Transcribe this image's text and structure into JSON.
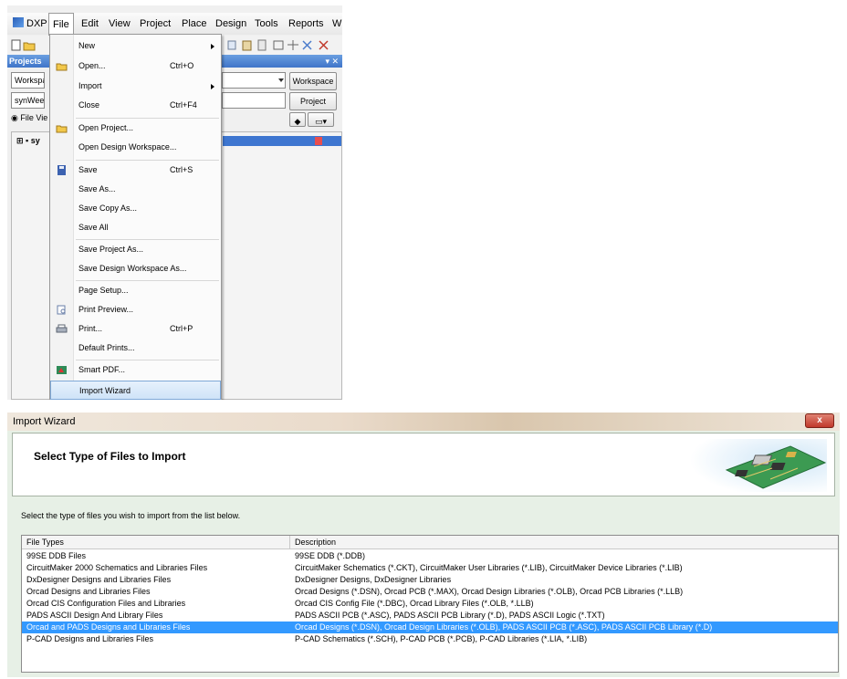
{
  "dxp": {
    "menubar": [
      "DXP",
      "File",
      "Edit",
      "View",
      "Project",
      "Place",
      "Design",
      "Tools",
      "Reports",
      "W"
    ],
    "projects_panel": {
      "title": "Projects",
      "workspace_field": "Workspa",
      "project_field": "synWee.I",
      "file_view_radio": "File Vie",
      "tree_item": "sy",
      "workspace_button": "Workspace",
      "project_button": "Project"
    },
    "file_menu": [
      {
        "label": "New",
        "shortcut": "",
        "submenu": true
      },
      {
        "label": "Open...",
        "shortcut": "Ctrl+O",
        "submenu": false
      },
      {
        "label": "Import",
        "shortcut": "",
        "submenu": true
      },
      {
        "label": "Close",
        "shortcut": "Ctrl+F4",
        "submenu": false
      },
      {
        "label": "Open Project...",
        "shortcut": "",
        "submenu": false
      },
      {
        "label": "Open Design Workspace...",
        "shortcut": "",
        "submenu": false
      },
      {
        "label": "Save",
        "shortcut": "Ctrl+S",
        "submenu": false
      },
      {
        "label": "Save As...",
        "shortcut": "",
        "submenu": false
      },
      {
        "label": "Save Copy As...",
        "shortcut": "",
        "submenu": false
      },
      {
        "label": "Save All",
        "shortcut": "",
        "submenu": false
      },
      {
        "label": "Save Project As...",
        "shortcut": "",
        "submenu": false
      },
      {
        "label": "Save Design Workspace As...",
        "shortcut": "",
        "submenu": false
      },
      {
        "label": "Page Setup...",
        "shortcut": "",
        "submenu": false
      },
      {
        "label": "Print Preview...",
        "shortcut": "",
        "submenu": false
      },
      {
        "label": "Print...",
        "shortcut": "Ctrl+P",
        "submenu": false
      },
      {
        "label": "Default Prints...",
        "shortcut": "",
        "submenu": false
      },
      {
        "label": "Smart PDF...",
        "shortcut": "",
        "submenu": false
      },
      {
        "label": "Import Wizard",
        "shortcut": "",
        "submenu": false,
        "highlighted": true
      }
    ]
  },
  "wizard": {
    "window_title": "Import Wizard",
    "close_glyph": "x",
    "header_title": "Select Type of Files to Import",
    "instruction": "Select the type of files you wish to import from the list below.",
    "columns": [
      "File Types",
      "Description"
    ],
    "rows": [
      {
        "type": "99SE DDB Files",
        "desc": "99SE DDB (*.DDB)"
      },
      {
        "type": "CircuitMaker 2000 Schematics and Libraries Files",
        "desc": "CircuitMaker Schematics (*.CKT), CircuitMaker User Libraries (*.LIB), CircuitMaker Device Libraries (*.LIB)"
      },
      {
        "type": "DxDesigner Designs and Libraries Files",
        "desc": "DxDesigner Designs, DxDesigner Libraries"
      },
      {
        "type": "Orcad Designs and Libraries Files",
        "desc": "Orcad Designs (*.DSN), Orcad PCB (*.MAX), Orcad Design Libraries (*.OLB), Orcad PCB Libraries (*.LLB)"
      },
      {
        "type": "Orcad CIS Configuration Files and Libraries",
        "desc": "Orcad CIS Config File (*.DBC), Orcad Library Files (*.OLB, *.LLB)"
      },
      {
        "type": "PADS ASCII Design And Library Files",
        "desc": "PADS ASCII PCB (*.ASC), PADS ASCII PCB Library (*.D), PADS ASCII Logic (*.TXT)"
      },
      {
        "type": "Orcad and PADS Designs and Libraries Files",
        "desc": "Orcad Designs (*.DSN), Orcad Design Libraries (*.OLB), PADS ASCII PCB (*.ASC), PADS ASCII PCB Library (*.D)",
        "selected": true
      },
      {
        "type": "P-CAD Designs and Libraries Files",
        "desc": "P-CAD Schematics (*.SCH), P-CAD PCB (*.PCB), P-CAD Libraries (*.LIA, *.LIB)"
      }
    ]
  }
}
